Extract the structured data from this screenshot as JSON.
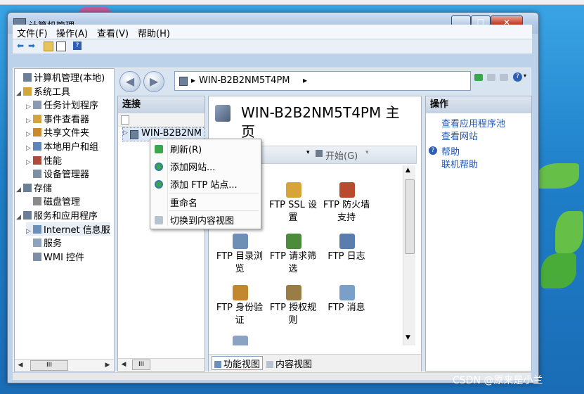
{
  "window": {
    "title": "计算机管理"
  },
  "menu": [
    "文件(F)",
    "操作(A)",
    "查看(V)",
    "帮助(H)"
  ],
  "tree": {
    "items": [
      {
        "label": "计算机管理(本地)",
        "level": 0,
        "arrow": ""
      },
      {
        "label": "系统工具",
        "level": 0,
        "arrow": "◢"
      },
      {
        "label": "任务计划程序",
        "level": 1,
        "arrow": "▷"
      },
      {
        "label": "事件查看器",
        "level": 1,
        "arrow": "▷"
      },
      {
        "label": "共享文件夹",
        "level": 1,
        "arrow": "▷"
      },
      {
        "label": "本地用户和组",
        "level": 1,
        "arrow": "▷"
      },
      {
        "label": "性能",
        "level": 1,
        "arrow": "▷"
      },
      {
        "label": "设备管理器",
        "level": 1,
        "arrow": ""
      },
      {
        "label": "存储",
        "level": 0,
        "arrow": "◢"
      },
      {
        "label": "磁盘管理",
        "level": 1,
        "arrow": ""
      },
      {
        "label": "服务和应用程序",
        "level": 0,
        "arrow": "◢"
      },
      {
        "label": "Internet 信息服",
        "level": 1,
        "arrow": "▷"
      },
      {
        "label": "服务",
        "level": 1,
        "arrow": ""
      },
      {
        "label": "WMI 控件",
        "level": 1,
        "arrow": ""
      }
    ],
    "scroll_thumb": "III"
  },
  "address": {
    "separator": "▸",
    "server": "WIN-B2B2NM5T4PM",
    "trail": "▸"
  },
  "connections": {
    "header": "连接",
    "node": "WIN-B2B2NM",
    "scroll_thumb": "III"
  },
  "center": {
    "title": "WIN-B2B2NM5T4PM 主页",
    "start_label": "开始(G)",
    "features": [
      {
        "label": "FTP SSL 设置",
        "color": "#d7a437"
      },
      {
        "label": "FTP 防火墙支持",
        "color": "#b94a2d"
      },
      {
        "label": "FTP 目录浏览",
        "color": "#6d8fb5"
      },
      {
        "label": "FTP 请求筛选",
        "color": "#4c8a3c"
      },
      {
        "label": "FTP 日志",
        "color": "#5a7db0"
      },
      {
        "label": "FTP 身份验证",
        "color": "#c2872f"
      },
      {
        "label": "FTP 授权规则",
        "color": "#9a7d46"
      },
      {
        "label": "FTP 消息",
        "color": "#7a9fc8"
      }
    ],
    "views": [
      "功能视图",
      "内容视图"
    ]
  },
  "actions": {
    "header": "操作",
    "links": [
      "查看应用程序池",
      "查看网站"
    ],
    "help": [
      "帮助",
      "联机帮助"
    ]
  },
  "context_menu": [
    "刷新(R)",
    "添加网站...",
    "添加 FTP 站点...",
    "重命名",
    "切换到内容视图"
  ],
  "watermark": "CSDN @原来是小兰",
  "colors": {
    "link": "#1d57b5",
    "title_bar": "#b4cbe6",
    "desktop": "#1f7fc8"
  }
}
